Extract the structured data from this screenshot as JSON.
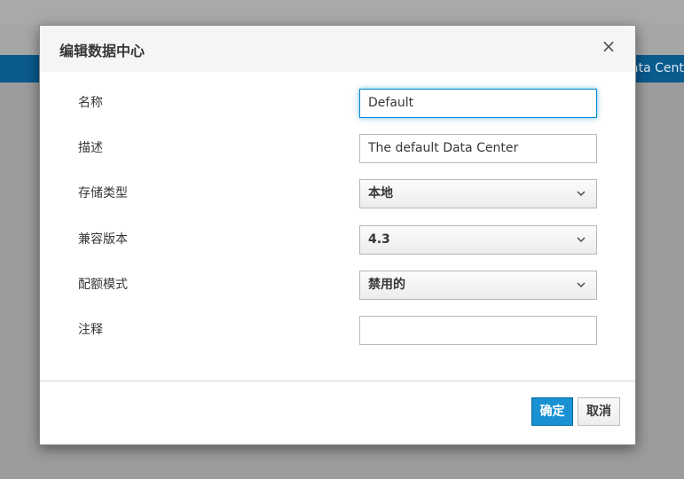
{
  "background": {
    "band_text": "ata Center"
  },
  "dialog": {
    "title": "编辑数据中心",
    "close_glyph": "×",
    "fields": {
      "name": {
        "label": "名称",
        "value": "Default"
      },
      "description": {
        "label": "描述",
        "value": "The default Data Center"
      },
      "storage_type": {
        "label": "存储类型",
        "value": "本地"
      },
      "compat_version": {
        "label": "兼容版本",
        "value": "4.3"
      },
      "quota_mode": {
        "label": "配额模式",
        "value": "禁用的"
      },
      "comment": {
        "label": "注释",
        "value": ""
      }
    },
    "buttons": {
      "ok": "确定",
      "cancel": "取消"
    }
  },
  "colors": {
    "primary": "#1a91d3",
    "focus": "#0088ce",
    "band": "#0a5a8e"
  },
  "icons": {
    "close": "close-icon",
    "chevron": "chevron-down-icon"
  }
}
